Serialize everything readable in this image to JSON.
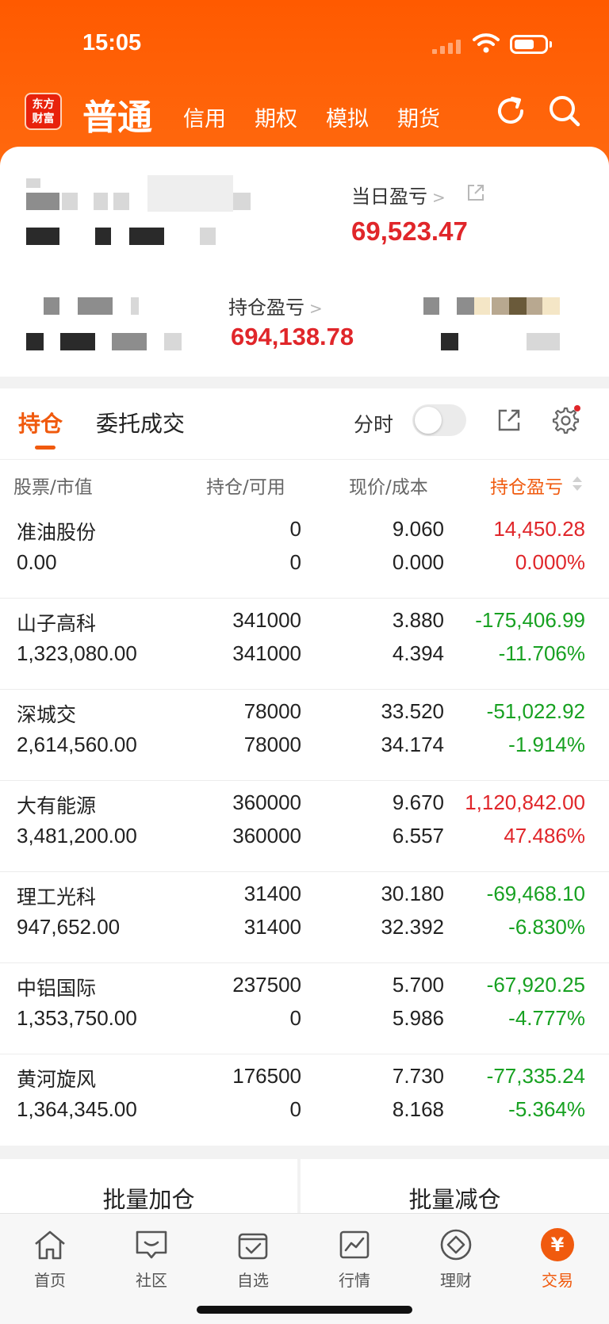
{
  "status_bar": {
    "time": "15:05"
  },
  "header": {
    "logo_line1": "东方",
    "logo_line2": "财富",
    "active_tab": "普通",
    "tabs": [
      "信用",
      "期权",
      "模拟",
      "期货"
    ],
    "icons": [
      "refresh-icon",
      "search-icon"
    ]
  },
  "summary": {
    "daily_pnl_label": "当日盈亏",
    "daily_pnl_value": "69,523.47",
    "position_pnl_label": "持仓盈亏",
    "position_pnl_value": "694,138.78",
    "chevron": ">"
  },
  "positions": {
    "tabs": [
      "持仓",
      "委托成交"
    ],
    "fenshi_label": "分时",
    "columns": [
      "股票/市值",
      "持仓/可用",
      "现价/成本",
      "持仓盈亏"
    ],
    "rows": [
      {
        "name": "准油股份",
        "market_value": "0.00",
        "holding": "0",
        "available": "0",
        "price": "9.060",
        "cost": "0.000",
        "pnl": "14,450.28",
        "pnl_pct": "0.000%",
        "trend": "up"
      },
      {
        "name": "山子高科",
        "market_value": "1,323,080.00",
        "holding": "341000",
        "available": "341000",
        "price": "3.880",
        "cost": "4.394",
        "pnl": "-175,406.99",
        "pnl_pct": "-11.706%",
        "trend": "down"
      },
      {
        "name": "深城交",
        "market_value": "2,614,560.00",
        "holding": "78000",
        "available": "78000",
        "price": "33.520",
        "cost": "34.174",
        "pnl": "-51,022.92",
        "pnl_pct": "-1.914%",
        "trend": "down"
      },
      {
        "name": "大有能源",
        "market_value": "3,481,200.00",
        "holding": "360000",
        "available": "360000",
        "price": "9.670",
        "cost": "6.557",
        "pnl": "1,120,842.00",
        "pnl_pct": "47.486%",
        "trend": "up"
      },
      {
        "name": "理工光科",
        "market_value": "947,652.00",
        "holding": "31400",
        "available": "31400",
        "price": "30.180",
        "cost": "32.392",
        "pnl": "-69,468.10",
        "pnl_pct": "-6.830%",
        "trend": "down"
      },
      {
        "name": "中铝国际",
        "market_value": "1,353,750.00",
        "holding": "237500",
        "available": "0",
        "price": "5.700",
        "cost": "5.986",
        "pnl": "-67,920.25",
        "pnl_pct": "-4.777%",
        "trend": "down"
      },
      {
        "name": "黄河旋风",
        "market_value": "1,364,345.00",
        "holding": "176500",
        "available": "0",
        "price": "7.730",
        "cost": "8.168",
        "pnl": "-77,335.24",
        "pnl_pct": "-5.364%",
        "trend": "down"
      }
    ]
  },
  "batch": {
    "add": "批量加仓",
    "reduce": "批量减仓"
  },
  "nav": {
    "items": [
      {
        "label": "首页",
        "icon": "home-icon"
      },
      {
        "label": "社区",
        "icon": "community-icon"
      },
      {
        "label": "自选",
        "icon": "watchlist-icon"
      },
      {
        "label": "行情",
        "icon": "market-icon"
      },
      {
        "label": "理财",
        "icon": "wealth-icon"
      },
      {
        "label": "交易",
        "icon": "trade-icon",
        "active": true
      }
    ],
    "trade_symbol": "¥"
  },
  "colors": {
    "brand": "#ff5a00",
    "accent": "#f05a0e",
    "up": "#e0262a",
    "down": "#17a121"
  }
}
